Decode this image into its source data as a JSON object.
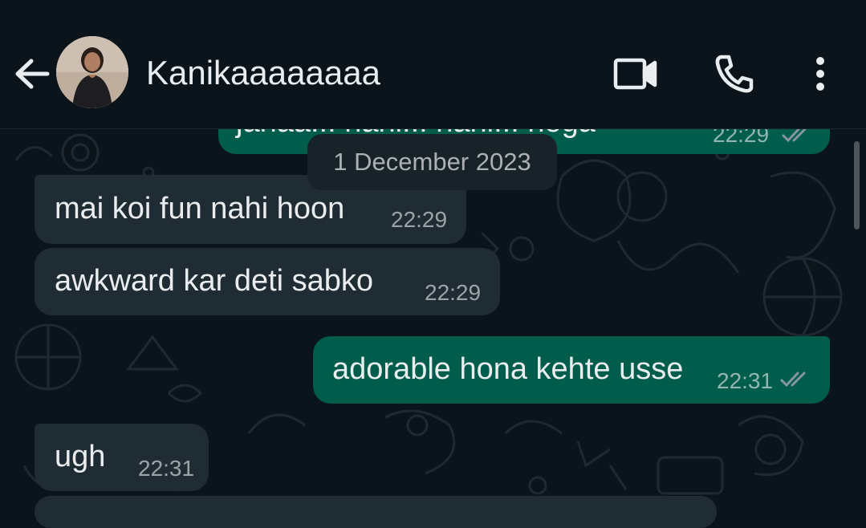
{
  "header": {
    "contact_name": "Kanikaaaaaaaa",
    "icons": [
      "back-arrow-icon",
      "video-call-icon",
      "phone-icon",
      "more-options-icon"
    ]
  },
  "date_chip": "1 December 2023",
  "messages": [
    {
      "direction": "out",
      "text": "janaa... nahi... nahi... hoga",
      "time": "22:29",
      "status": "read",
      "partially_visible": true
    },
    {
      "direction": "in",
      "text": "mai koi fun nahi hoon",
      "time": "22:29"
    },
    {
      "direction": "in",
      "text": "awkward kar deti sabko",
      "time": "22:29"
    },
    {
      "direction": "out",
      "text": "adorable hona kehte usse",
      "time": "22:31",
      "status": "read"
    },
    {
      "direction": "in",
      "text": "ugh",
      "time": "22:31"
    }
  ],
  "colors": {
    "background": "#0b141a",
    "incoming_bubble": "#202c33",
    "outgoing_bubble": "#005c4b",
    "text": "#e9edef",
    "read_tick": "#8696a0"
  }
}
